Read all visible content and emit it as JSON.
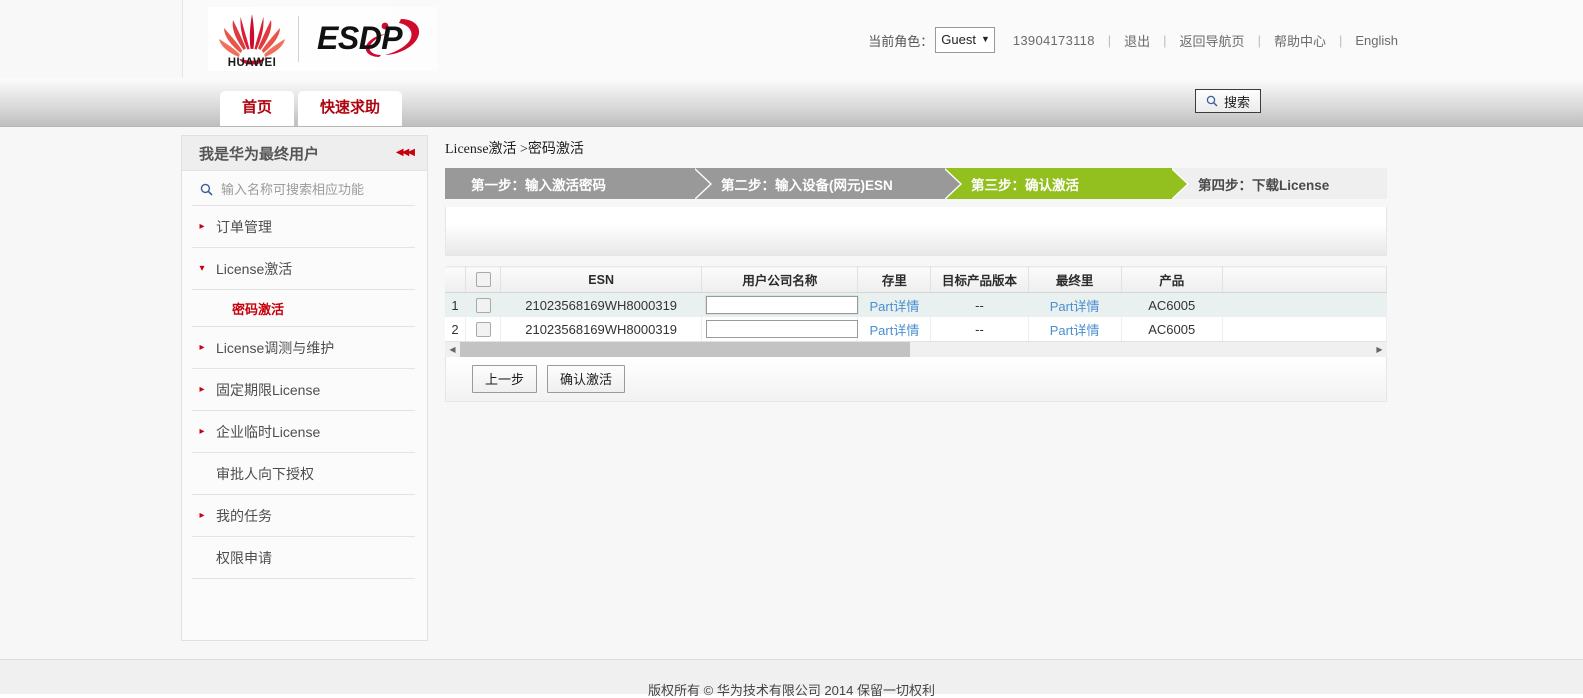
{
  "header": {
    "logo_huawei": "huawei-logo",
    "logo_esdp": "ESDP",
    "role_label": "当前角色：",
    "role_value": "Guest",
    "phone": "13904173118",
    "links": [
      {
        "label": "退出"
      },
      {
        "label": "返回导航页"
      },
      {
        "label": "帮助中心"
      },
      {
        "label": "English"
      }
    ],
    "separator": "|"
  },
  "nav": {
    "tabs": [
      {
        "label": "首页"
      },
      {
        "label": "快速求助"
      }
    ],
    "search_button": "搜索"
  },
  "sidebar": {
    "title": "我是华为最终用户",
    "collapse_icon": "◀◀◀",
    "search_placeholder": "输入名称可搜索相应功能",
    "search_value": "",
    "items": [
      {
        "label": "订单管理",
        "arrow": "▸",
        "has_arrow": true
      },
      {
        "label": "License激活",
        "arrow": "▾",
        "has_arrow": true,
        "expanded": true
      },
      {
        "label": "License调测与维护",
        "arrow": "▸",
        "has_arrow": true
      },
      {
        "label": "固定期限License",
        "arrow": "▸",
        "has_arrow": true
      },
      {
        "label": "企业临时License",
        "arrow": "▸",
        "has_arrow": true
      },
      {
        "label": "审批人向下授权",
        "arrow": "",
        "has_arrow": false
      },
      {
        "label": "我的任务",
        "arrow": "▸",
        "has_arrow": true
      },
      {
        "label": "权限申请",
        "arrow": "",
        "has_arrow": false
      }
    ],
    "sub_item": {
      "label": "密码激活",
      "parent": "License激活"
    }
  },
  "main": {
    "breadcrumb": "License激活 >密码激活",
    "steps": [
      {
        "label": "第一步：输入激活密码",
        "state": "done"
      },
      {
        "label": "第二步：输入设备(网元)ESN",
        "state": "done"
      },
      {
        "label": "第三步：确认激活",
        "state": "active"
      },
      {
        "label": "第四步：下载License",
        "state": "todo"
      }
    ],
    "table": {
      "columns": [
        {
          "key": "idx",
          "label": ""
        },
        {
          "key": "chk",
          "label": ""
        },
        {
          "key": "esn",
          "label": "ESN"
        },
        {
          "key": "company",
          "label": "用户公司名称"
        },
        {
          "key": "store",
          "label": "存里"
        },
        {
          "key": "version",
          "label": "目标产品版本"
        },
        {
          "key": "final",
          "label": "最终里"
        },
        {
          "key": "product",
          "label": "产品"
        },
        {
          "key": "tail",
          "label": ""
        }
      ],
      "rows": [
        {
          "idx": "1",
          "esn": "21023568169WH8000319",
          "company_value": "",
          "store": "Part详情",
          "version": "--",
          "final": "Part详情",
          "product": "AC6005",
          "highlighted": true
        },
        {
          "idx": "2",
          "esn": "21023568169WH8000319",
          "company_value": "",
          "store": "Part详情",
          "version": "--",
          "final": "Part详情",
          "product": "AC6005",
          "highlighted": false
        }
      ]
    },
    "scrollbar": {
      "left_arrow": "◀",
      "right_arrow": "▶"
    },
    "buttons": [
      {
        "label": "上一步"
      },
      {
        "label": "确认激活"
      }
    ]
  },
  "footer": {
    "copyright": "版权所有 © 华为技术有限公司 2014  保留一切权利"
  },
  "colors": {
    "brand_red": "#c7000b",
    "step_active_green": "#93c01f",
    "step_done_gray": "#999999",
    "link_blue": "#4a8fd0"
  }
}
